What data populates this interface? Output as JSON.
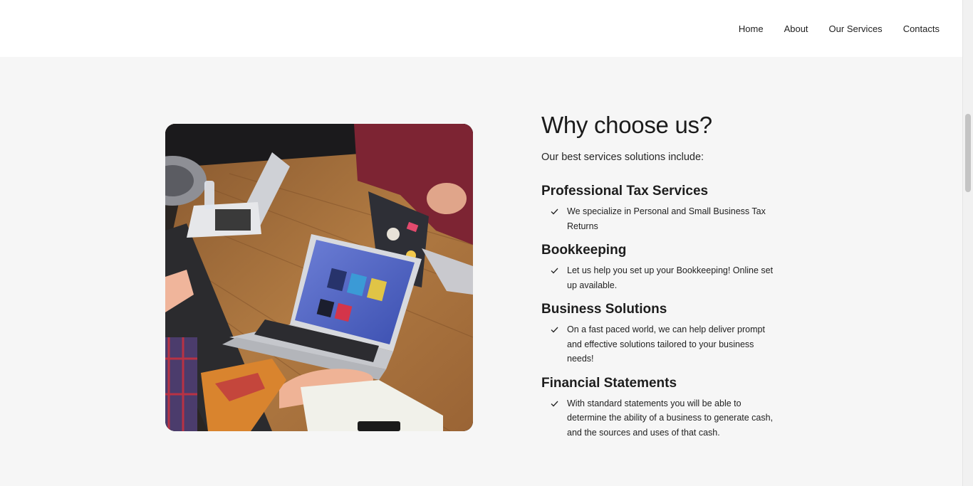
{
  "nav": {
    "items": [
      "Home",
      "About",
      "Our Services",
      "Contacts"
    ]
  },
  "photo": {
    "icon": "meeting-laptops-photo"
  },
  "section": {
    "title": "Why choose us?",
    "intro": "Our best services solutions include:",
    "services": [
      {
        "title": "Professional Tax Services",
        "desc": "We specialize in Personal and Small Business Tax Returns"
      },
      {
        "title": "Bookkeeping",
        "desc": "Let us help you set up your Bookkeeping! Online set up available."
      },
      {
        "title": "Business Solutions",
        "desc": "On a fast paced world, we can help deliver prompt and effective solutions tailored to your business needs!"
      },
      {
        "title": "Financial Statements",
        "desc": "With standard statements you will be able to determine the ability of a business to generate cash, and the sources and uses of that cash."
      }
    ]
  },
  "colors": {
    "background": "#f6f6f6",
    "header": "#ffffff",
    "text": "#1d1d1f"
  }
}
